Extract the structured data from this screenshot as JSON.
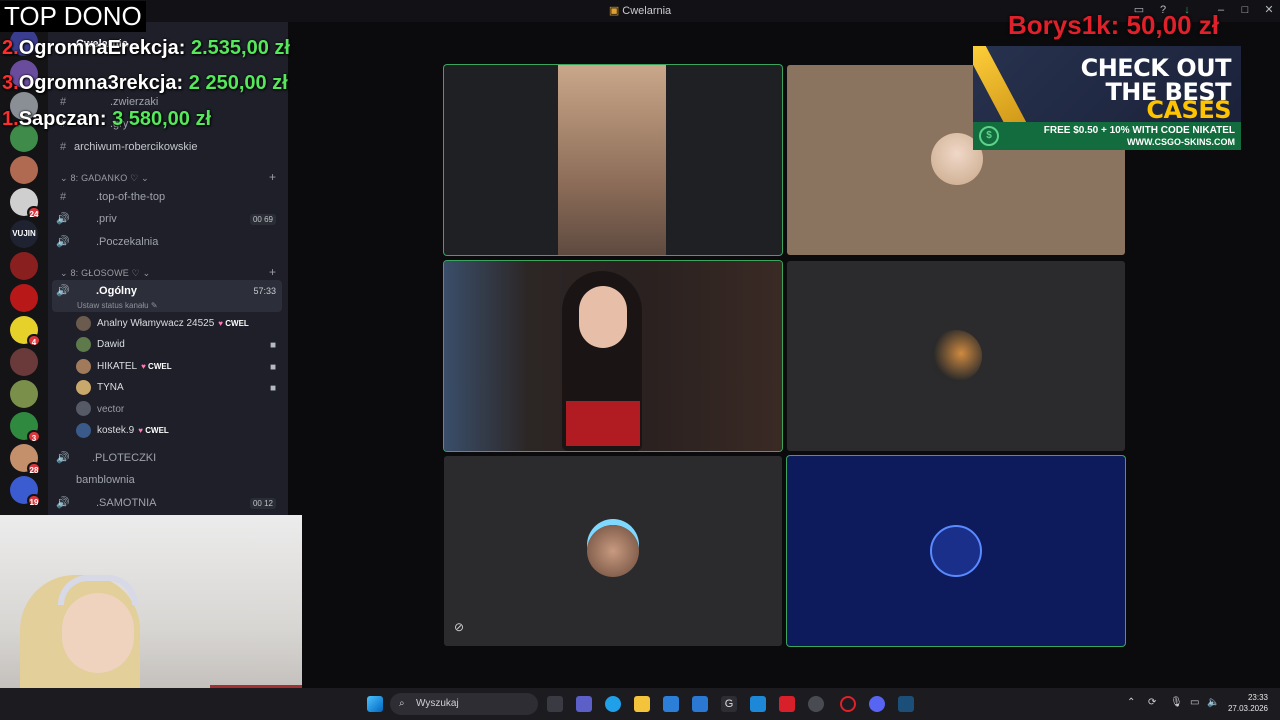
{
  "window": {
    "title": "Cwelarnia"
  },
  "server": {
    "name": "Cwelarnia"
  },
  "donations": {
    "header": "TOP DONO",
    "entries": [
      {
        "rank": "2.",
        "name": "OgromnaErekcja:",
        "amount": "2.535,00 zł"
      },
      {
        "rank": "3.",
        "name": "Ogromna3rekcja:",
        "amount": "2 250,00 zł"
      },
      {
        "rank": "1.",
        "name": "Sapczan:",
        "amount": "3 580,00 zł"
      }
    ],
    "latest": "Borys1k: 50,00 zł"
  },
  "server_list": [
    {
      "label": "",
      "color": "#3a3d8f",
      "badge": ""
    },
    {
      "label": "",
      "color": "#6a4c9c",
      "badge": ""
    },
    {
      "label": "",
      "color": "#8a8f96",
      "badge": ""
    },
    {
      "label": "",
      "color": "#3f8b4a",
      "badge": ""
    },
    {
      "label": "",
      "color": "#b06a52",
      "badge": ""
    },
    {
      "label": "",
      "color": "#cfcfcf",
      "badge": "24"
    },
    {
      "label": "VUJIN",
      "color": "#1f2230",
      "badge": ""
    },
    {
      "label": "",
      "color": "#8a1f1f",
      "badge": ""
    },
    {
      "label": "",
      "color": "#b81818",
      "badge": ""
    },
    {
      "label": "",
      "color": "#e6d02a",
      "badge": "4"
    },
    {
      "label": "",
      "color": "#6a3a3a",
      "badge": ""
    },
    {
      "label": "",
      "color": "#7a8f4a",
      "badge": ""
    },
    {
      "label": "",
      "color": "#2f8a3f",
      "badge": "3"
    },
    {
      "label": "",
      "color": "#c48f6b",
      "badge": "28"
    },
    {
      "label": "",
      "color": "#3b5bd0",
      "badge": "19"
    }
  ],
  "channels": {
    "top": [
      {
        "name": ".zwierzaki",
        "icon": "#"
      },
      {
        "name": ".gry",
        "icon": "#"
      },
      {
        "name": "archiwum-robercikowskie",
        "icon": "#"
      }
    ],
    "cat_gadanko": "GADANKO",
    "gadanko": [
      {
        "name": ".top-of-the-top",
        "icon": "#",
        "count": ""
      },
      {
        "name": ".priv",
        "icon": "🔊",
        "count": "00 69"
      },
      {
        "name": ".Poczekalnia",
        "icon": "🔊",
        "count": ""
      }
    ],
    "cat_glosowe": "GŁOSOWE",
    "voice_active": {
      "name": ".Ogólny",
      "timer": "57:33",
      "status": "Ustaw status kanału"
    },
    "members": [
      {
        "name": "Analny Włamywacz 24525",
        "tag": "CWEL",
        "color": "#6b5a4e"
      },
      {
        "name": "Dawid",
        "tag": "",
        "color": "#5e7a4a"
      },
      {
        "name": "НІКАТЕL",
        "tag": "CWEL",
        "color": "#a07a5a"
      },
      {
        "name": "TYNA",
        "tag": "",
        "color": "#c8a86b"
      },
      {
        "name": "vector",
        "tag": "",
        "color": "#555a66"
      },
      {
        "name": "kostek.9",
        "tag": "CWEL",
        "color": "#3a5a8a"
      }
    ],
    "after": [
      {
        "name": ".PLOTECZKI",
        "icon": "🔊",
        "count": ""
      },
      {
        "name": "bamblownia",
        "icon": "",
        "count": ""
      },
      {
        "name": ".SAMOTNIA",
        "icon": "🔊",
        "count": "00 12"
      }
    ]
  },
  "ad": {
    "line1": "CHECK OUT",
    "line2": "THE BEST",
    "line3": "CASES",
    "promo1": "FREE $0.50 + 10% WITH CODE NIKATEL",
    "promo2": "WWW.CSGO-SKINS.COM"
  },
  "taskbar": {
    "search_placeholder": "Wyszukaj",
    "time": "23:33",
    "date": "27.03.2026"
  }
}
